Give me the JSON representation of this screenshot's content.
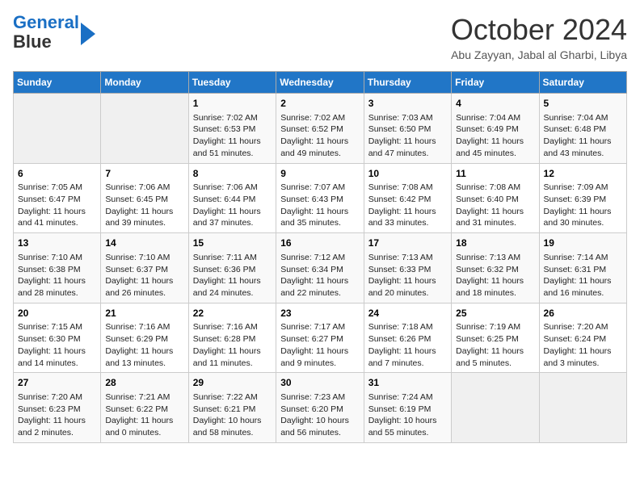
{
  "header": {
    "logo_line1": "General",
    "logo_line2": "Blue",
    "month_title": "October 2024",
    "location": "Abu Zayyan, Jabal al Gharbi, Libya"
  },
  "weekdays": [
    "Sunday",
    "Monday",
    "Tuesday",
    "Wednesday",
    "Thursday",
    "Friday",
    "Saturday"
  ],
  "weeks": [
    [
      {
        "day": "",
        "info": ""
      },
      {
        "day": "",
        "info": ""
      },
      {
        "day": "1",
        "info": "Sunrise: 7:02 AM\nSunset: 6:53 PM\nDaylight: 11 hours and 51 minutes."
      },
      {
        "day": "2",
        "info": "Sunrise: 7:02 AM\nSunset: 6:52 PM\nDaylight: 11 hours and 49 minutes."
      },
      {
        "day": "3",
        "info": "Sunrise: 7:03 AM\nSunset: 6:50 PM\nDaylight: 11 hours and 47 minutes."
      },
      {
        "day": "4",
        "info": "Sunrise: 7:04 AM\nSunset: 6:49 PM\nDaylight: 11 hours and 45 minutes."
      },
      {
        "day": "5",
        "info": "Sunrise: 7:04 AM\nSunset: 6:48 PM\nDaylight: 11 hours and 43 minutes."
      }
    ],
    [
      {
        "day": "6",
        "info": "Sunrise: 7:05 AM\nSunset: 6:47 PM\nDaylight: 11 hours and 41 minutes."
      },
      {
        "day": "7",
        "info": "Sunrise: 7:06 AM\nSunset: 6:45 PM\nDaylight: 11 hours and 39 minutes."
      },
      {
        "day": "8",
        "info": "Sunrise: 7:06 AM\nSunset: 6:44 PM\nDaylight: 11 hours and 37 minutes."
      },
      {
        "day": "9",
        "info": "Sunrise: 7:07 AM\nSunset: 6:43 PM\nDaylight: 11 hours and 35 minutes."
      },
      {
        "day": "10",
        "info": "Sunrise: 7:08 AM\nSunset: 6:42 PM\nDaylight: 11 hours and 33 minutes."
      },
      {
        "day": "11",
        "info": "Sunrise: 7:08 AM\nSunset: 6:40 PM\nDaylight: 11 hours and 31 minutes."
      },
      {
        "day": "12",
        "info": "Sunrise: 7:09 AM\nSunset: 6:39 PM\nDaylight: 11 hours and 30 minutes."
      }
    ],
    [
      {
        "day": "13",
        "info": "Sunrise: 7:10 AM\nSunset: 6:38 PM\nDaylight: 11 hours and 28 minutes."
      },
      {
        "day": "14",
        "info": "Sunrise: 7:10 AM\nSunset: 6:37 PM\nDaylight: 11 hours and 26 minutes."
      },
      {
        "day": "15",
        "info": "Sunrise: 7:11 AM\nSunset: 6:36 PM\nDaylight: 11 hours and 24 minutes."
      },
      {
        "day": "16",
        "info": "Sunrise: 7:12 AM\nSunset: 6:34 PM\nDaylight: 11 hours and 22 minutes."
      },
      {
        "day": "17",
        "info": "Sunrise: 7:13 AM\nSunset: 6:33 PM\nDaylight: 11 hours and 20 minutes."
      },
      {
        "day": "18",
        "info": "Sunrise: 7:13 AM\nSunset: 6:32 PM\nDaylight: 11 hours and 18 minutes."
      },
      {
        "day": "19",
        "info": "Sunrise: 7:14 AM\nSunset: 6:31 PM\nDaylight: 11 hours and 16 minutes."
      }
    ],
    [
      {
        "day": "20",
        "info": "Sunrise: 7:15 AM\nSunset: 6:30 PM\nDaylight: 11 hours and 14 minutes."
      },
      {
        "day": "21",
        "info": "Sunrise: 7:16 AM\nSunset: 6:29 PM\nDaylight: 11 hours and 13 minutes."
      },
      {
        "day": "22",
        "info": "Sunrise: 7:16 AM\nSunset: 6:28 PM\nDaylight: 11 hours and 11 minutes."
      },
      {
        "day": "23",
        "info": "Sunrise: 7:17 AM\nSunset: 6:27 PM\nDaylight: 11 hours and 9 minutes."
      },
      {
        "day": "24",
        "info": "Sunrise: 7:18 AM\nSunset: 6:26 PM\nDaylight: 11 hours and 7 minutes."
      },
      {
        "day": "25",
        "info": "Sunrise: 7:19 AM\nSunset: 6:25 PM\nDaylight: 11 hours and 5 minutes."
      },
      {
        "day": "26",
        "info": "Sunrise: 7:20 AM\nSunset: 6:24 PM\nDaylight: 11 hours and 3 minutes."
      }
    ],
    [
      {
        "day": "27",
        "info": "Sunrise: 7:20 AM\nSunset: 6:23 PM\nDaylight: 11 hours and 2 minutes."
      },
      {
        "day": "28",
        "info": "Sunrise: 7:21 AM\nSunset: 6:22 PM\nDaylight: 11 hours and 0 minutes."
      },
      {
        "day": "29",
        "info": "Sunrise: 7:22 AM\nSunset: 6:21 PM\nDaylight: 10 hours and 58 minutes."
      },
      {
        "day": "30",
        "info": "Sunrise: 7:23 AM\nSunset: 6:20 PM\nDaylight: 10 hours and 56 minutes."
      },
      {
        "day": "31",
        "info": "Sunrise: 7:24 AM\nSunset: 6:19 PM\nDaylight: 10 hours and 55 minutes."
      },
      {
        "day": "",
        "info": ""
      },
      {
        "day": "",
        "info": ""
      }
    ]
  ]
}
